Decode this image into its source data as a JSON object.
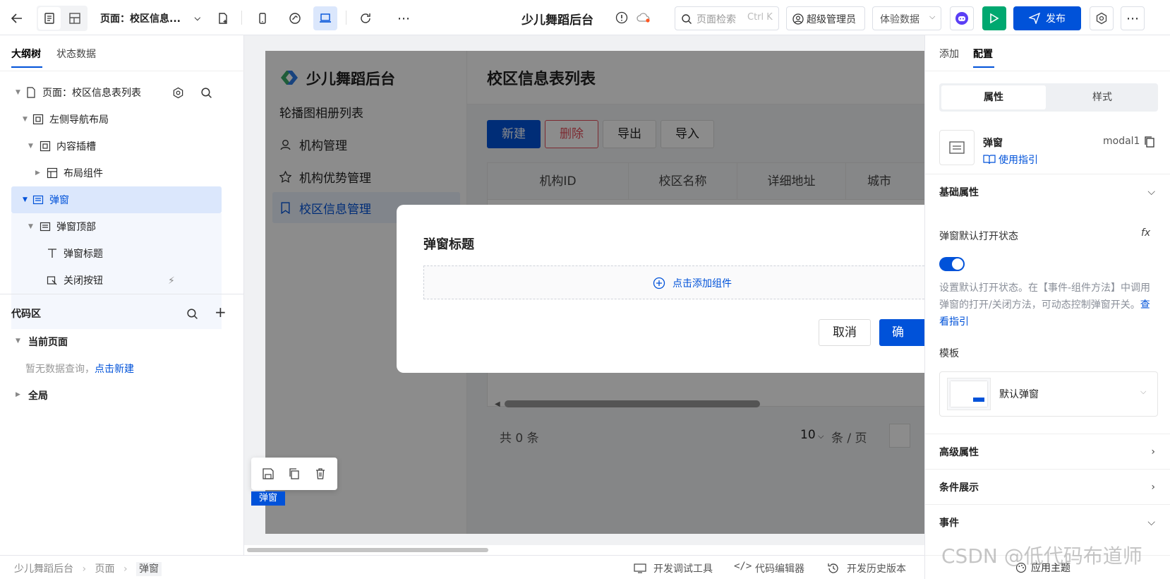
{
  "topbar": {
    "page_select": "页面：校区信息...",
    "app_title": "少儿舞蹈后台",
    "search_placeholder": "页面检索",
    "search_shortcut": "Ctrl K",
    "user": "超级管理员",
    "data_mode": "体验数据",
    "publish": "发布"
  },
  "left": {
    "tabs": [
      "大纲树",
      "状态数据"
    ],
    "tree": [
      {
        "label": "页面：校区信息表列表"
      },
      {
        "label": "左侧导航布局"
      },
      {
        "label": "内容插槽"
      },
      {
        "label": "布局组件"
      },
      {
        "label": "弹窗"
      },
      {
        "label": "弹窗顶部"
      },
      {
        "label": "弹窗标题"
      },
      {
        "label": "关闭按钮"
      }
    ],
    "code_area": {
      "title": "代码区",
      "current_page": "当前页面",
      "empty_text": "暂无数据查询，",
      "create_link": "点击新建",
      "global": "全局"
    }
  },
  "preview": {
    "brand": "少儿舞蹈后台",
    "nav": [
      "轮播图相册列表",
      "机构管理",
      "机构优势管理",
      "校区信息管理"
    ],
    "page_title": "校区信息表列表",
    "buttons": {
      "new": "新建",
      "delete": "删除",
      "export": "导出",
      "import": "导入"
    },
    "columns": [
      "机构ID",
      "校区名称",
      "详细地址",
      "城市"
    ],
    "pagination": {
      "total": "共 0 条",
      "page_size": "10",
      "unit": "条 / 页"
    },
    "modal": {
      "title": "弹窗标题",
      "add_component": "点击添加组件",
      "cancel": "取消",
      "confirm": "确"
    },
    "selection_label": "弹窗"
  },
  "right": {
    "tabs": [
      "添加",
      "配置"
    ],
    "subtabs": [
      "属性",
      "样式"
    ],
    "component": {
      "name": "弹窗",
      "id": "modal1",
      "guide": "使用指引"
    },
    "basic": {
      "title": "基础属性",
      "default_open_label": "弹窗默认打开状态",
      "fx": "fx",
      "toggle_on": true,
      "desc": "设置默认打开状态。在【事件-组件方法】中调用弹窗的打开/关闭方法，可动态控制弹窗开关。",
      "desc_link": "查看指引",
      "template_label": "模板",
      "template_value": "默认弹窗"
    },
    "sections": [
      "高级属性",
      "条件展示",
      "事件"
    ],
    "theme": "应用主题"
  },
  "statusbar": {
    "breadcrumbs": [
      "少儿舞蹈后台",
      "页面",
      "弹窗"
    ],
    "tools": [
      "开发调试工具",
      "代码编辑器",
      "开发历史版本"
    ]
  },
  "watermark": "CSDN @低代码布道师",
  "colors": {
    "primary": "#0052d9",
    "selection_bg": "#dbe7fc",
    "danger": "#e34d59"
  }
}
